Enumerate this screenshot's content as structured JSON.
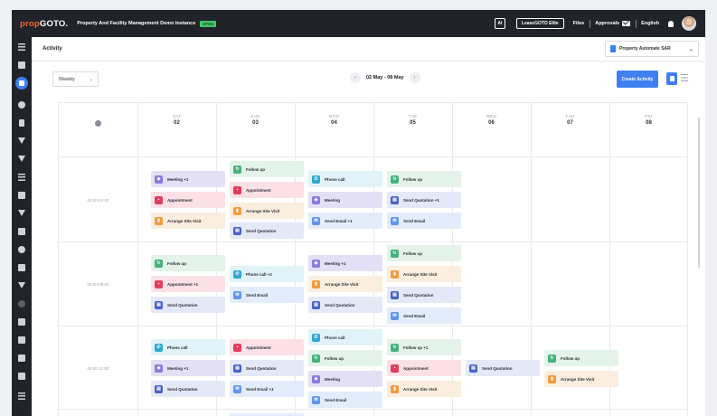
{
  "topbar": {
    "logo_a": "prop",
    "logo_b": "GOTO.",
    "instance": "Property And Facility Management Demo Instance",
    "stage_tag": "STAG",
    "ai_label": "AI",
    "lease_label": "LeaseGOTO Elite",
    "files_label": "Files",
    "approvals_label": "Approvals",
    "language_label": "English"
  },
  "header": {
    "title": "Activity",
    "property_select": "Property Automate SAR"
  },
  "toolbar": {
    "view_mode": "Weekly",
    "date_range": "02 May - 08 May",
    "create_label": "Create Activity"
  },
  "days": [
    {
      "name": "SAT",
      "num": "02"
    },
    {
      "name": "SUN",
      "num": "03"
    },
    {
      "name": "MON",
      "num": "04"
    },
    {
      "name": "TUE",
      "num": "05"
    },
    {
      "name": "WED",
      "num": "06"
    },
    {
      "name": "THU",
      "num": "07"
    },
    {
      "name": "FRI",
      "num": "08"
    }
  ],
  "slots": [
    "00:00-04:00",
    "04:00-08:00",
    "08:00-12:00"
  ],
  "cards": {
    "s0": {
      "sat": [
        "Meeting +1",
        "Appointment",
        "Arrange Site Visit"
      ],
      "sun": [
        "Follow up",
        "Appointment",
        "Arrange Site Visit",
        "Send Quotation"
      ],
      "mon": [
        "Phone call",
        "Meeting",
        "Send Email +1"
      ],
      "tue": [
        "Follow up",
        "Send Quotation +1",
        "Send Email"
      ]
    },
    "s1": {
      "sat": [
        "Follow up",
        "Appointment +1",
        "Send Quotation"
      ],
      "sun": [
        "Phone call +2",
        "Send Email"
      ],
      "mon": [
        "Meeting +1",
        "Arrange Site Visit",
        "Send Quotation"
      ],
      "tue": [
        "Follow up",
        "Arrange Site Visit",
        "Send Quotation",
        "Send Email"
      ]
    },
    "s2": {
      "sat": [
        "Phone call",
        "Meeting +1",
        "Send Quotation"
      ],
      "sun": [
        "Appointment",
        "Send Quotation",
        "Send Email +1"
      ],
      "mon": [
        "Phone call",
        "Follow up",
        "Meeting",
        "Send Email"
      ],
      "tue": [
        "Follow up +1",
        "Appointment",
        "Arrange Site Visit"
      ],
      "wed": [
        "Send Quotation"
      ],
      "thu": [
        "Follow up",
        "Arrange Site Visit"
      ]
    }
  },
  "colors": {
    "topbar": "#20232a",
    "accent": "#3f7ff0",
    "logo_accent": "#f26a2e",
    "stage_tag": "#3ec96a"
  }
}
